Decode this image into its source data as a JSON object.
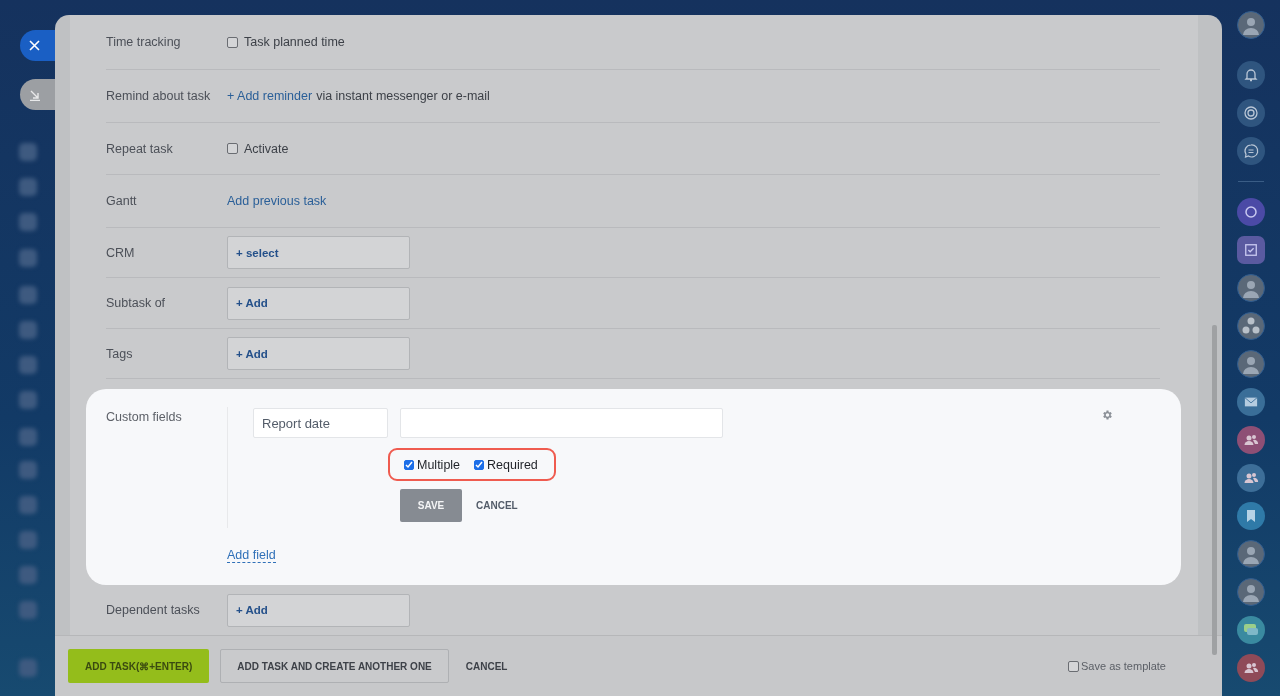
{
  "rows": [
    {
      "label": "Time tracking",
      "kind": "checkbox",
      "text": "Task planned time",
      "checked": false
    },
    {
      "label": "Remind about task",
      "kind": "link",
      "link": "+ Add reminder",
      "text": "via instant messenger or e-mail"
    },
    {
      "label": "Repeat task",
      "kind": "checkbox",
      "text": "Activate",
      "checked": false
    },
    {
      "label": "Gantt",
      "kind": "link",
      "link": "Add previous task"
    },
    {
      "label": "CRM",
      "kind": "selector",
      "button": "+ select"
    },
    {
      "label": "Subtask of",
      "kind": "selector",
      "button": "+ Add"
    },
    {
      "label": "Tags",
      "kind": "selector",
      "button": "+ Add"
    },
    {
      "label": "Custom fields",
      "kind": "custom",
      "name_value": "Report date",
      "options": [
        {
          "label": "Multiple",
          "checked": true
        },
        {
          "label": "Required",
          "checked": true
        }
      ],
      "save": "SAVE",
      "cancel": "CANCEL",
      "add_link": "Add field"
    },
    {
      "label": "Dependent tasks",
      "kind": "selector",
      "button": "+ Add"
    }
  ],
  "footer": {
    "primary": "ADD TASK(⌘+ENTER)",
    "secondary": "ADD TASK AND CREATE ANOTHER ONE",
    "cancel": "CANCEL",
    "template": {
      "label": "Save as template",
      "checked": false
    }
  }
}
